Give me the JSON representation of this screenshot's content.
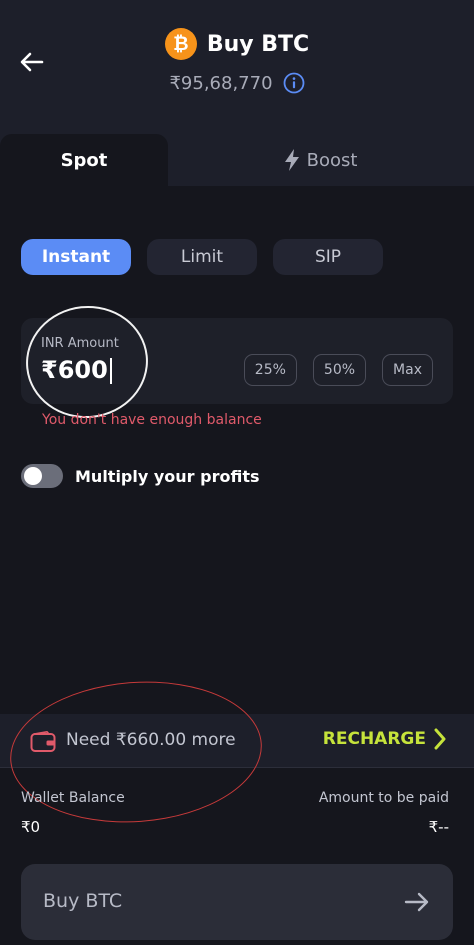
{
  "header": {
    "title": "Buy BTC",
    "coin_symbol": "₿",
    "price": "₹95,68,770",
    "icons": {
      "back": "arrow-left-icon",
      "coin": "bitcoin-icon",
      "info": "info-icon"
    },
    "colors": {
      "bitcoin": "#f7931a",
      "info": "#5b8cf5"
    }
  },
  "tabs": [
    {
      "label": "Spot",
      "active": true
    },
    {
      "label": "Boost",
      "active": false,
      "icon": "bolt-icon"
    }
  ],
  "order_types": [
    {
      "label": "Instant",
      "active": true
    },
    {
      "label": "Limit",
      "active": false
    },
    {
      "label": "SIP",
      "active": false
    }
  ],
  "amount": {
    "label": "INR Amount",
    "value": "₹600",
    "quick_picks": [
      "25%",
      "50%",
      "Max"
    ]
  },
  "error": "You don't have enough balance",
  "multiply": {
    "label": "Multiply your profits",
    "enabled": false
  },
  "recharge": {
    "message": "Need ₹660.00 more",
    "action": "RECHARGE",
    "accent_color": "#c6e33b",
    "icons": {
      "wallet": "wallet-icon",
      "chevron": "chevron-right-icon"
    }
  },
  "balance": {
    "wallet_label": "Wallet Balance",
    "wallet_value": "₹0",
    "paid_label": "Amount to be paid",
    "paid_value": "₹--"
  },
  "buy_button": {
    "label": "Buy BTC",
    "icon": "arrow-right-icon"
  }
}
